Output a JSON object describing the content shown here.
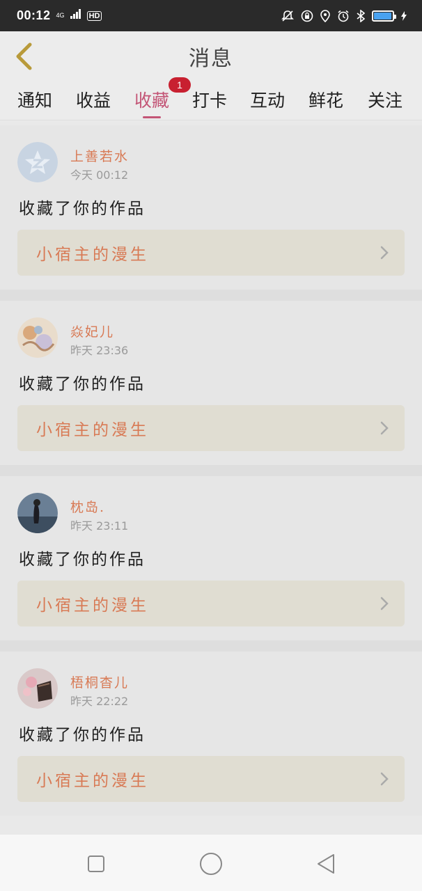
{
  "status": {
    "time": "00:12",
    "net": "4G",
    "hd": "HD",
    "battery_level": 0.95,
    "battery_color": "#49a2f0"
  },
  "header": {
    "title": "消息"
  },
  "tabs": [
    {
      "label": "通知"
    },
    {
      "label": "收益"
    },
    {
      "label": "收藏"
    },
    {
      "label": "打卡"
    },
    {
      "label": "互动"
    },
    {
      "label": "鲜花"
    },
    {
      "label": "关注"
    }
  ],
  "active_tab": "收藏",
  "badge": {
    "count": "1"
  },
  "messages": [
    {
      "user": "上善若水",
      "time": "今天 00:12",
      "text": "收藏了你的作品",
      "work": "小宿主的漫生",
      "avatar": "default-avatar-icon"
    },
    {
      "user": "焱妃儿",
      "time": "昨天 23:36",
      "text": "收藏了你的作品",
      "work": "小宿主的漫生",
      "avatar": "user-photo"
    },
    {
      "user": "枕岛.",
      "time": "昨天 23:11",
      "text": "收藏了你的作品",
      "work": "小宿主的漫生",
      "avatar": "user-photo"
    },
    {
      "user": "梧桐杳儿",
      "time": "昨天 22:22",
      "text": "收藏了你的作品",
      "work": "小宿主的漫生",
      "avatar": "user-photo"
    }
  ],
  "colors": {
    "accent": "#c35576",
    "name": "#d87a55",
    "badge": "#c82030",
    "back": "#b89a3a"
  }
}
